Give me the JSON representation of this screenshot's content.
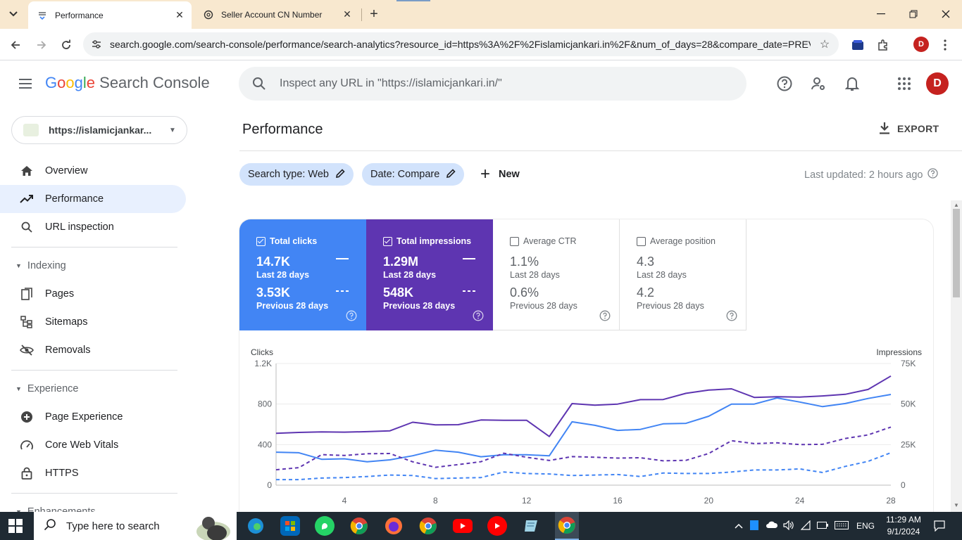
{
  "browser": {
    "tabs": [
      {
        "title": "Performance",
        "active": true
      },
      {
        "title": "Seller Account CN Number",
        "active": false
      }
    ],
    "url": "search.google.com/search-console/performance/search-analytics?resource_id=https%3A%2F%2Fislamicjankari.in%2F&num_of_days=28&compare_date=PREV",
    "profile_initial": "D"
  },
  "header": {
    "logo_google": [
      "G",
      "o",
      "o",
      "g",
      "l",
      "e"
    ],
    "logo_product": "Search Console",
    "search_placeholder": "Inspect any URL in \"https://islamicjankari.in/\"",
    "avatar_initial": "D"
  },
  "sidebar": {
    "property": "https://islamicjankar...",
    "items_top": [
      {
        "label": "Overview",
        "icon": "home-icon"
      },
      {
        "label": "Performance",
        "icon": "trending-icon",
        "active": true
      },
      {
        "label": "URL inspection",
        "icon": "search-icon"
      }
    ],
    "indexing_label": "Indexing",
    "indexing_items": [
      {
        "label": "Pages",
        "icon": "pages-icon"
      },
      {
        "label": "Sitemaps",
        "icon": "sitemap-icon"
      },
      {
        "label": "Removals",
        "icon": "removals-icon"
      }
    ],
    "experience_label": "Experience",
    "experience_items": [
      {
        "label": "Page Experience",
        "icon": "plus-circle-icon"
      },
      {
        "label": "Core Web Vitals",
        "icon": "gauge-icon"
      },
      {
        "label": "HTTPS",
        "icon": "lock-icon"
      }
    ],
    "enhancements_label": "Enhancements"
  },
  "main": {
    "title": "Performance",
    "export_label": "EXPORT",
    "chips": [
      {
        "label": "Search type: Web"
      },
      {
        "label": "Date: Compare"
      }
    ],
    "new_label": "New",
    "last_updated": "Last updated: 2 hours ago"
  },
  "metrics": [
    {
      "name": "Total clicks",
      "current": "14.7K",
      "current_label": "Last 28 days",
      "previous": "3.53K",
      "previous_label": "Previous 28 days",
      "checked": true
    },
    {
      "name": "Total impressions",
      "current": "1.29M",
      "current_label": "Last 28 days",
      "previous": "548K",
      "previous_label": "Previous 28 days",
      "checked": true
    },
    {
      "name": "Average CTR",
      "current": "1.1%",
      "current_label": "Last 28 days",
      "previous": "0.6%",
      "previous_label": "Previous 28 days",
      "checked": false
    },
    {
      "name": "Average position",
      "current": "4.3",
      "current_label": "Last 28 days",
      "previous": "4.2",
      "previous_label": "Previous 28 days",
      "checked": false
    }
  ],
  "colors": {
    "clicks": "#4285f4",
    "impressions": "#5e35b1",
    "active_nav": "#e8f0fe",
    "chip": "#d2e3fc"
  },
  "chart_data": {
    "type": "line",
    "ylabel_left": "Clicks",
    "ylabel_right": "Impressions",
    "left_ticks": [
      "0",
      "400",
      "800",
      "1.2K"
    ],
    "left_range": [
      0,
      1200
    ],
    "right_ticks": [
      "0",
      "25K",
      "50K",
      "75K"
    ],
    "right_range": [
      0,
      75000
    ],
    "x_ticks": [
      "4",
      "8",
      "12",
      "16",
      "20",
      "24",
      "28"
    ],
    "x": [
      1,
      2,
      3,
      4,
      5,
      6,
      7,
      8,
      9,
      10,
      11,
      12,
      13,
      14,
      15,
      16,
      17,
      18,
      19,
      20,
      21,
      22,
      23,
      24,
      25,
      26,
      27,
      28
    ],
    "grid": true,
    "series": [
      {
        "name": "Total clicks",
        "axis": "left",
        "style": "solid",
        "color": "#4285f4",
        "values": [
          325,
          320,
          255,
          260,
          230,
          250,
          290,
          345,
          325,
          280,
          300,
          300,
          290,
          625,
          590,
          540,
          550,
          605,
          610,
          680,
          800,
          800,
          860,
          820,
          775,
          805,
          855,
          895
        ]
      },
      {
        "name": "Total impressions",
        "axis": "right",
        "style": "solid",
        "color": "#5e35b1",
        "values": [
          32000,
          32500,
          32800,
          32700,
          33000,
          33500,
          38800,
          37200,
          37300,
          40200,
          40000,
          40000,
          30000,
          50300,
          49300,
          50000,
          52700,
          52800,
          56600,
          58600,
          59400,
          54100,
          54500,
          54300,
          55000,
          56000,
          59000,
          67300
        ]
      },
      {
        "name": "Total clicks",
        "axis": "left",
        "style": "dashed",
        "color": "#4285f4",
        "values": [
          55,
          55,
          70,
          75,
          85,
          100,
          95,
          65,
          70,
          75,
          130,
          115,
          110,
          95,
          100,
          105,
          85,
          120,
          115,
          115,
          130,
          150,
          150,
          160,
          125,
          185,
          235,
          320
        ]
      },
      {
        "name": "Total impressions",
        "axis": "right",
        "style": "dashed",
        "color": "#5e35b1",
        "values": [
          9500,
          10800,
          18800,
          18300,
          19400,
          19500,
          14400,
          11000,
          12700,
          14500,
          19700,
          17200,
          15200,
          17600,
          17200,
          16700,
          16900,
          15000,
          15300,
          19500,
          27400,
          25600,
          26100,
          25000,
          25200,
          28800,
          31000,
          35800
        ]
      }
    ]
  },
  "taskbar": {
    "search_placeholder": "Type here to search",
    "language": "ENG",
    "time": "11:29 AM",
    "date": "9/1/2024"
  }
}
